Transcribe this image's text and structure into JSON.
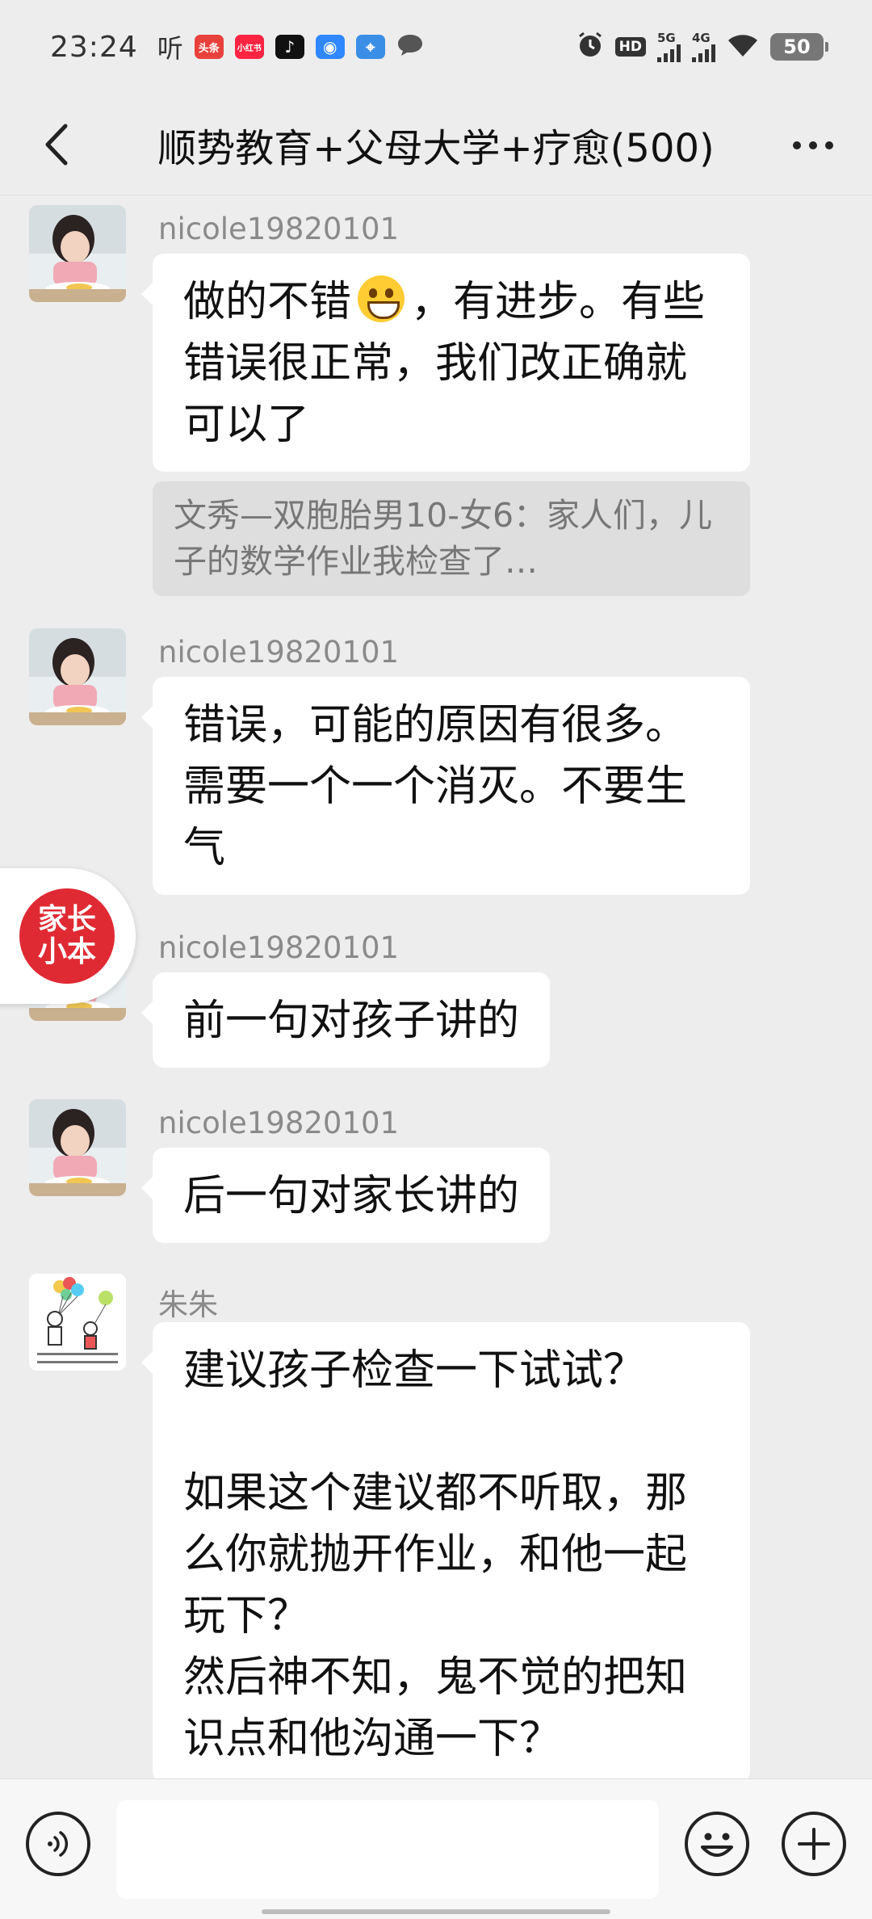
{
  "status_bar": {
    "time": "23:24",
    "left_icons": [
      {
        "name": "hearing-app-icon",
        "label": "听",
        "color": "#333333"
      },
      {
        "name": "toutiao-app-icon",
        "label": "头条",
        "color": "#e8413c"
      },
      {
        "name": "xiaohongshu-app-icon",
        "label": "小红书",
        "color": "#ff2442"
      },
      {
        "name": "tiktok-app-icon",
        "label": "♪",
        "color": "#111111"
      },
      {
        "name": "browser-app-icon",
        "label": "◉",
        "color": "#2f88ff"
      },
      {
        "name": "maps-app-icon",
        "label": "⌖",
        "color": "#3a8ee6"
      },
      {
        "name": "chat-bubble-icon",
        "label": "",
        "color": "#555555"
      }
    ],
    "hd_label": "HD",
    "network_5g": "5G",
    "network_4g": "4G",
    "battery": "50"
  },
  "header": {
    "title": "顺势教育+父母大学+疗愈(500)"
  },
  "messages": [
    {
      "sender": "nicole19820101",
      "text_part1": "做的不错",
      "text_part2": "，有进步。有些错误很正常，我们改正确就可以了",
      "quote": "文秀—双胞胎男10-女6：家人们，儿子的数学作业我检查了…"
    },
    {
      "sender": "nicole19820101",
      "text": "错误，可能的原因有很多。需要一个一个消灭。不要生气"
    },
    {
      "sender": "nicole19820101",
      "text": "前一句对孩子讲的"
    },
    {
      "sender": "nicole19820101",
      "text": "后一句对家长讲的"
    },
    {
      "sender": "朱朱",
      "line1": "建议孩子检查一下试试？",
      "line2": "如果这个建议都不听取，那么你就抛开作业，和他一起玩下？",
      "line3": "然后神不知，鬼不觉的把知识点和他沟通一下？"
    }
  ],
  "floating_badge": {
    "line1": "家长",
    "line2": "小本"
  },
  "input_bar": {
    "placeholder": ""
  }
}
